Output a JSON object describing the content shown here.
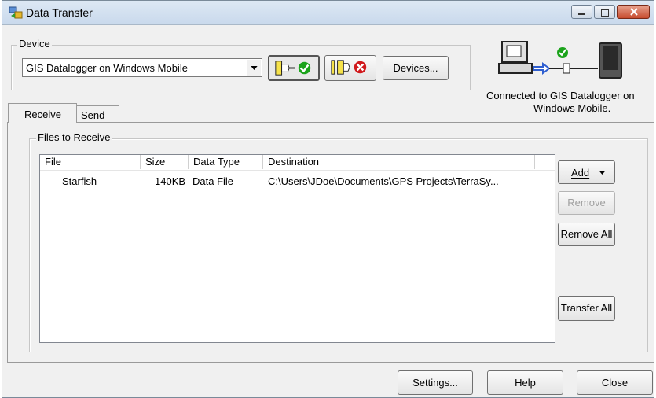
{
  "window": {
    "title": "Data Transfer",
    "icon": "data-transfer-app-icon"
  },
  "device": {
    "group_label": "Device",
    "selected": "GIS Datalogger on Windows Mobile",
    "connect_icon": "connect-device-icon",
    "disconnect_icon": "disconnect-device-icon",
    "devices_button": "Devices...",
    "status": "Connected to GIS Datalogger on Windows Mobile.",
    "status_line1": "Connected to GIS Datalogger on",
    "status_line2": "Windows Mobile."
  },
  "tabs": [
    {
      "label": "Receive",
      "active": true
    },
    {
      "label": "Send",
      "active": false
    }
  ],
  "files": {
    "group_label": "Files to Receive",
    "columns": [
      "File",
      "Size",
      "Data Type",
      "Destination"
    ],
    "rows": [
      {
        "file": "Starfish",
        "size": "140KB",
        "type": "Data File",
        "destination": "C:\\Users\\JDoe\\Documents\\GPS Projects\\TerraSy..."
      }
    ]
  },
  "side_buttons": {
    "add": "Add",
    "remove": "Remove",
    "remove_all": "Remove All",
    "transfer_all": "Transfer All"
  },
  "footer": {
    "settings": "Settings...",
    "help": "Help",
    "close": "Close"
  },
  "colors": {
    "ok_green": "#1aa31a",
    "error_red": "#d0191c",
    "titlebar": "#c9d9ec"
  }
}
